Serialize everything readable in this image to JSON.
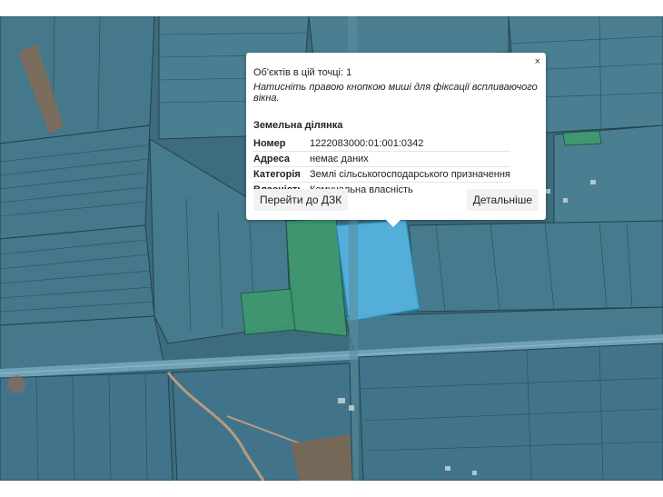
{
  "popup": {
    "close_label": "×",
    "count": "Об'єктів в цій точці: 1",
    "hint": "Натисніть правою кнопкою миші для фіксації вспливаючого вікна.",
    "section_title": "Земельна ділянка",
    "rows": [
      {
        "key": "Номер",
        "value": "1222083000:01:001:0342"
      },
      {
        "key": "Адреса",
        "value": "немає даних"
      },
      {
        "key": "Категорія",
        "value": "Землі сільськогосподарського призначення"
      },
      {
        "key": "Власність",
        "value": "Комунальна власність"
      }
    ],
    "button_left": "Перейти до ДЗК",
    "button_right": "Детальніше"
  },
  "colors": {
    "parcel_fill": "#3f7286",
    "parcel_border": "#1e3f4d",
    "selected_parcel": "#4fb3e0",
    "green_parcel": "#3f9a6e",
    "road": "#6fa1b6"
  }
}
